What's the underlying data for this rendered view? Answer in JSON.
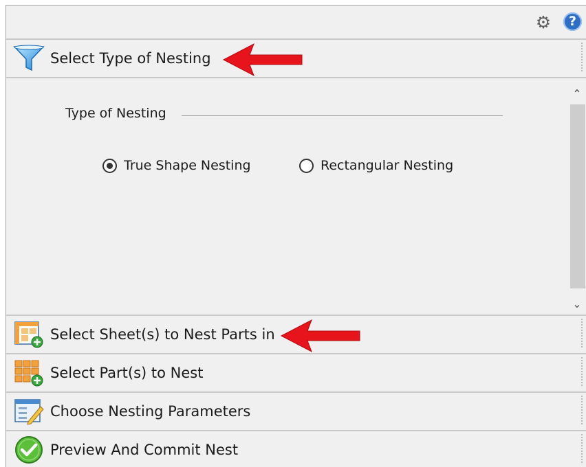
{
  "toolbar": {
    "settings_icon": "gear-icon",
    "help_icon": "help-icon",
    "help_glyph": "?"
  },
  "panels": [
    {
      "title": "Select Type of Nesting",
      "icon": "funnel-icon"
    },
    {
      "title": "Select Sheet(s) to Nest Parts in",
      "icon": "sheet-add-icon"
    },
    {
      "title": "Select Part(s) to Nest",
      "icon": "parts-grid-add-icon"
    },
    {
      "title": "Choose Nesting Parameters",
      "icon": "parameters-edit-icon"
    },
    {
      "title": "Preview And Commit Nest",
      "icon": "checkmark-circle-icon"
    }
  ],
  "nesting_type": {
    "group_label": "Type of Nesting",
    "options": [
      {
        "label": "True Shape Nesting",
        "selected": true
      },
      {
        "label": "Rectangular Nesting",
        "selected": false
      }
    ]
  },
  "annotation_arrow_color": "#e8141b"
}
